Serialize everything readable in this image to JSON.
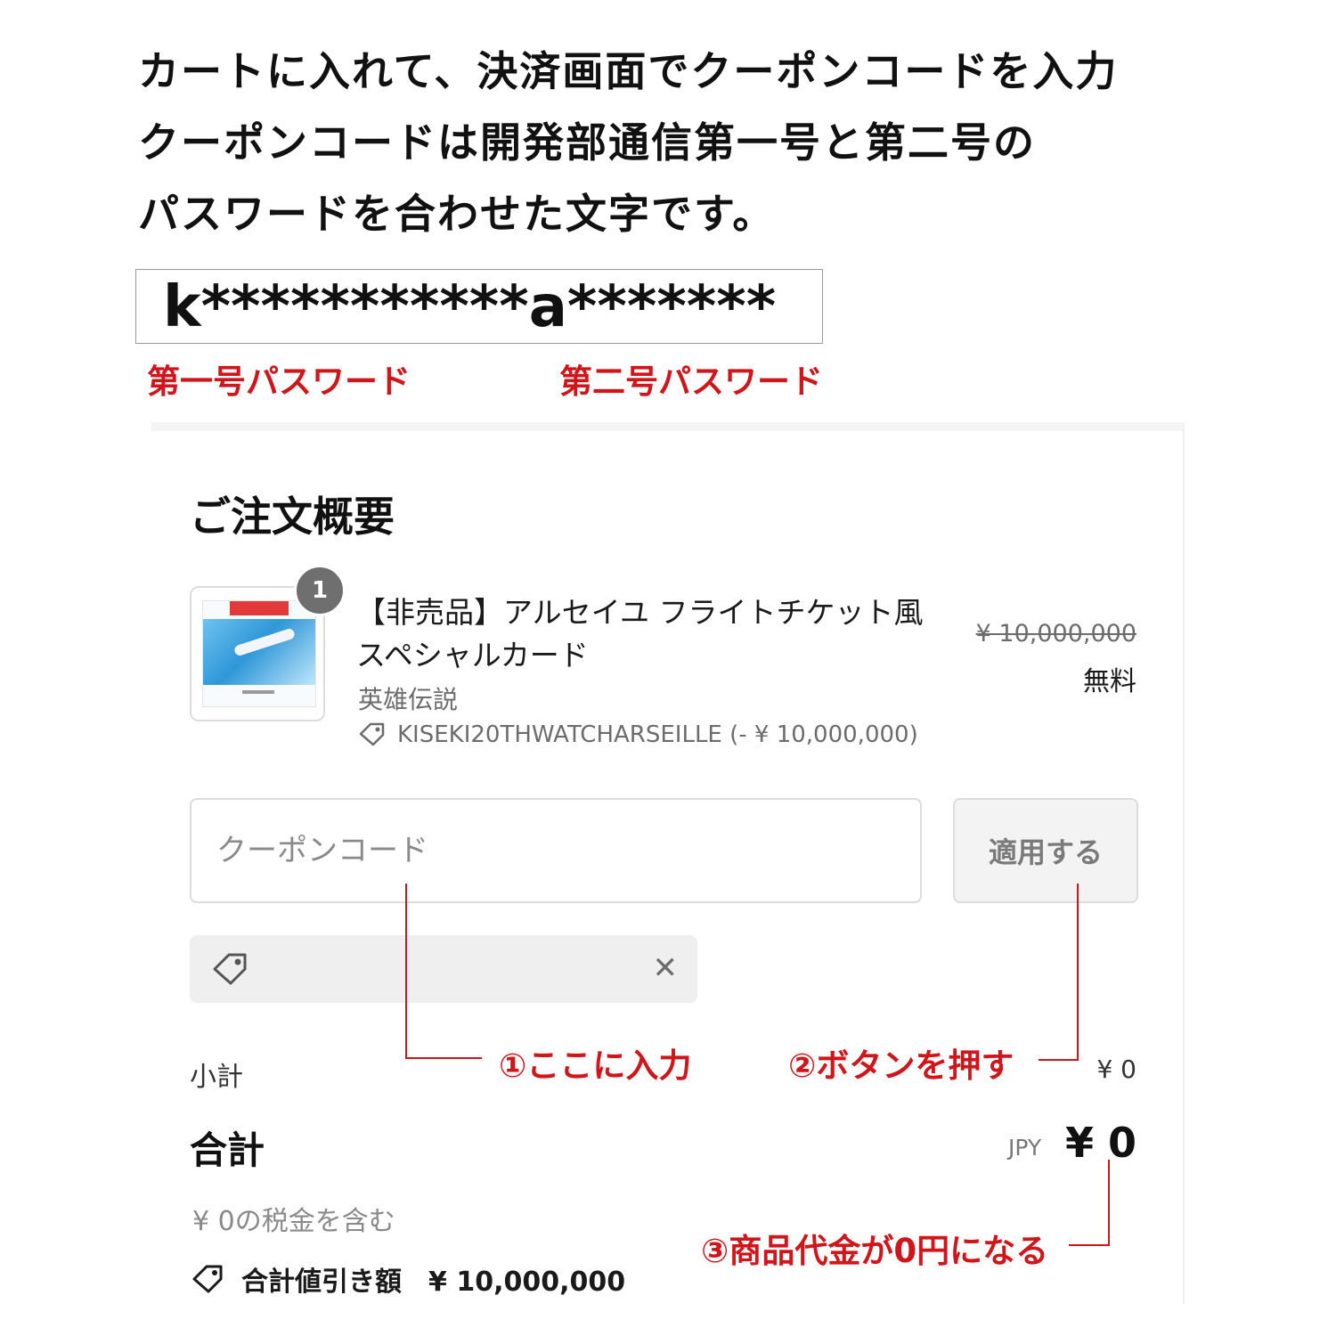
{
  "instructions": {
    "lines": [
      "カートに入れて、決済画面でクーポンコードを入力",
      "クーポンコードは開発部通信第一号と第二号の",
      "パスワードを合わせた文字です。"
    ]
  },
  "code_example": {
    "text": "k***********a*******",
    "label_first": "第一号パスワード",
    "label_second": "第二号パスワード"
  },
  "order_summary": {
    "title": "ご注文概要",
    "item": {
      "quantity": "1",
      "name_line1": "【非売品】アルセイユ フライトチケット風",
      "name_line2": "スペシャルカード",
      "variant": "英雄伝説",
      "discount": "KISEKI20THWATCHARSEILLE (- ¥ 10,000,000)",
      "original_price": "¥ 10,000,000",
      "price": "無料"
    },
    "coupon": {
      "placeholder": "クーポンコード",
      "value": "",
      "apply_label": "適用する"
    },
    "subtotal_label": "小計",
    "subtotal_value": "¥ 0",
    "total_label": "合計",
    "currency": "JPY",
    "total_value": "¥ 0",
    "tax_note": "¥ 0の税金を含む",
    "savings": "合計値引き額　¥ 10,000,000"
  },
  "annotations": {
    "step1": "①ここに入力",
    "step2": "②ボタンを押す",
    "step3": "③商品代金が0円になる"
  },
  "colors": {
    "annotation_red": "#d0161b",
    "badge_gray": "#6f6f6f",
    "chip_bg": "#efefef"
  }
}
